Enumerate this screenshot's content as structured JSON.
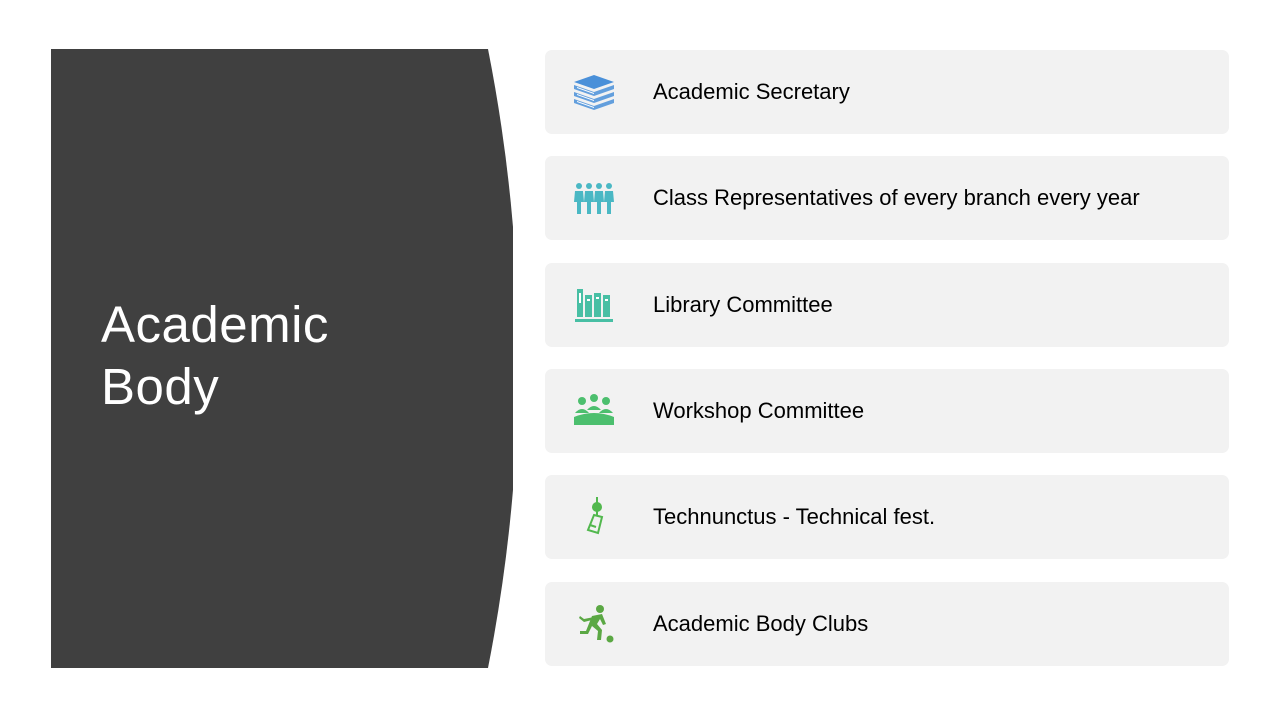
{
  "slide": {
    "title_lines": [
      "Academic",
      "Body"
    ],
    "panel_color": "#404040"
  },
  "items": [
    {
      "label": "Academic Secretary",
      "icon": "books-icon",
      "icon_color": "#4a90d9"
    },
    {
      "label": "Class Representatives of every branch every year",
      "icon": "people-group-icon",
      "icon_color": "#4ab8c4"
    },
    {
      "label": "Library Committee",
      "icon": "bookshelf-icon",
      "icon_color": "#48bfa4"
    },
    {
      "label": "Workshop Committee",
      "icon": "meeting-icon",
      "icon_color": "#4cbf6e"
    },
    {
      "label": "Technunctus  - Technical fest.",
      "icon": "wind-chime-icon",
      "icon_color": "#52b84e"
    },
    {
      "label": "Academic Body Clubs",
      "icon": "soccer-player-icon",
      "icon_color": "#5ba844"
    }
  ]
}
